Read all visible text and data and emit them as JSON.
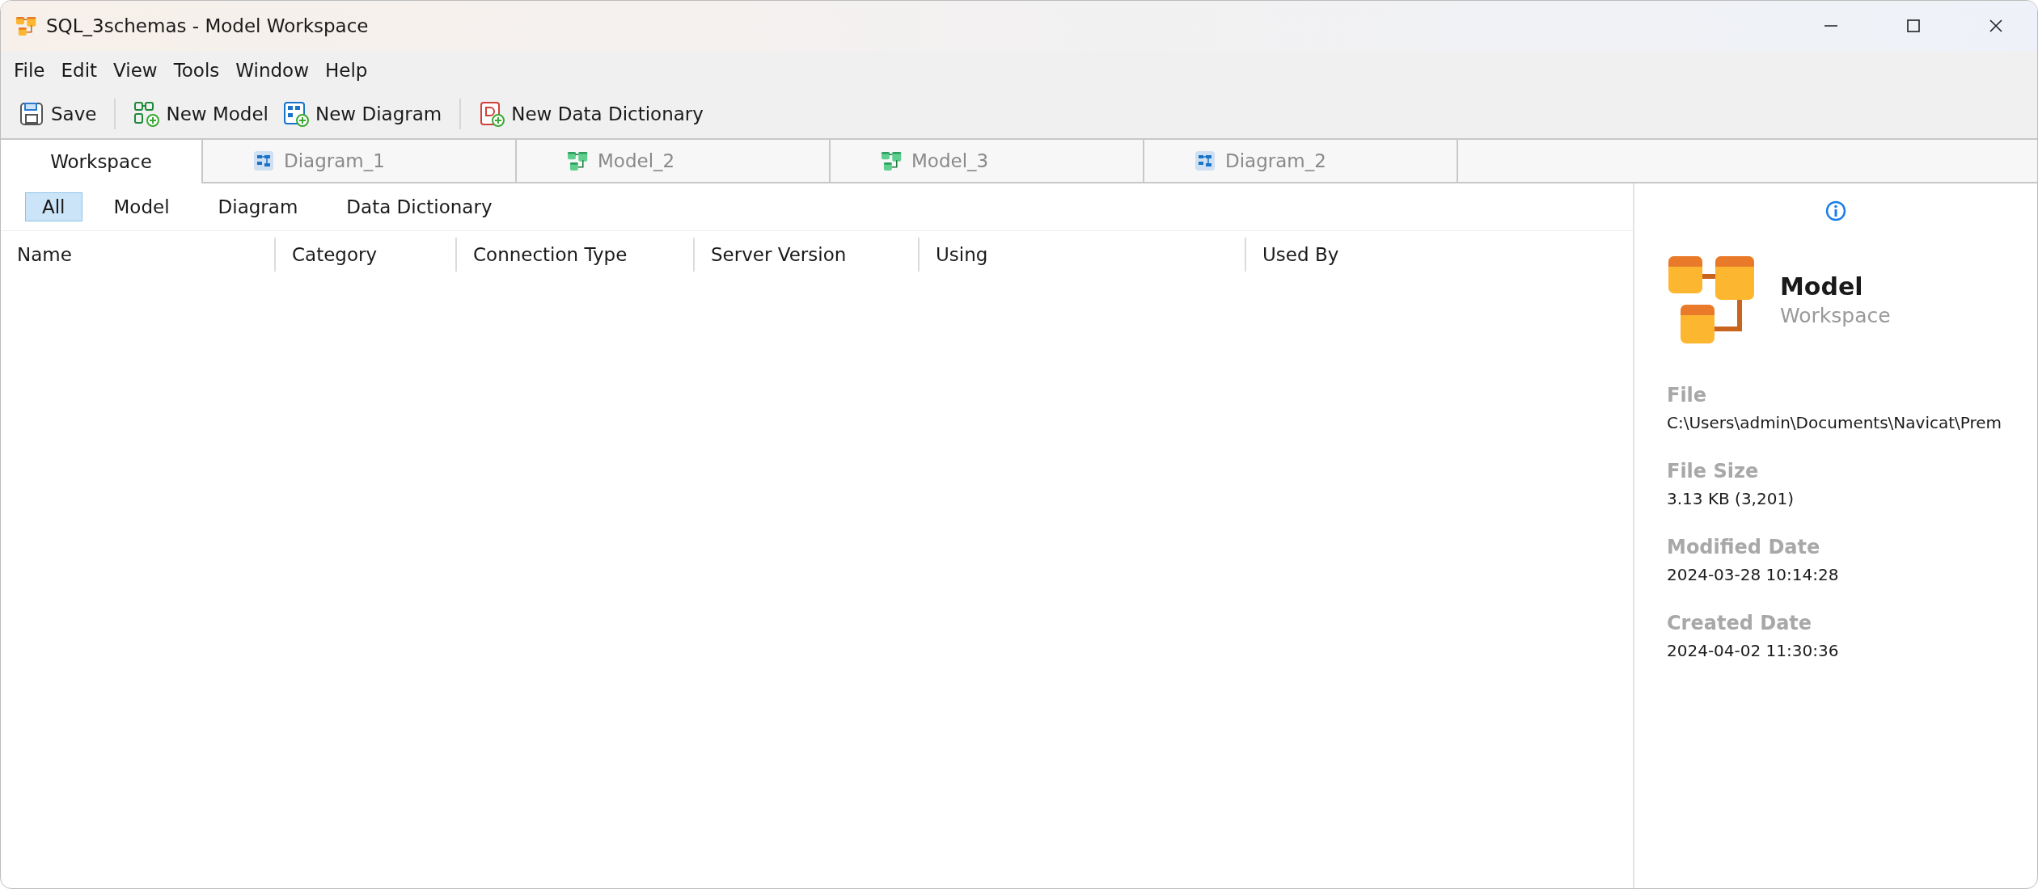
{
  "window": {
    "title": "SQL_3schemas - Model Workspace"
  },
  "menu": [
    "File",
    "Edit",
    "View",
    "Tools",
    "Window",
    "Help"
  ],
  "toolbar": [
    [
      {
        "label": "Save",
        "kind": "save"
      }
    ],
    [
      {
        "label": "New Model",
        "kind": "model"
      },
      {
        "label": "New Diagram",
        "kind": "diagram"
      }
    ],
    [
      {
        "label": "New Data Dictionary",
        "kind": "dictionary"
      }
    ]
  ],
  "tabs": [
    {
      "label": "Workspace",
      "kind": "workspace",
      "selected": true
    },
    {
      "label": "Diagram_1",
      "kind": "diagram",
      "selected": false
    },
    {
      "label": "Model_2",
      "kind": "model",
      "selected": false
    },
    {
      "label": "Model_3",
      "kind": "model",
      "selected": false
    },
    {
      "label": "Diagram_2",
      "kind": "diagram",
      "selected": false
    }
  ],
  "filters": [
    {
      "label": "All",
      "selected": true
    },
    {
      "label": "Model",
      "selected": false
    },
    {
      "label": "Diagram",
      "selected": false
    },
    {
      "label": "Data Dictionary",
      "selected": false
    }
  ],
  "table": {
    "columns": [
      "Name",
      "Category",
      "Connection Type",
      "Server Version",
      "Using",
      "Used By"
    ]
  },
  "info_panel": {
    "title": "Model",
    "subtitle": "Workspace",
    "fields": [
      {
        "label": "File",
        "value": "C:\\Users\\admin\\Documents\\Navicat\\Prem"
      },
      {
        "label": "File Size",
        "value": "3.13 KB (3,201)"
      },
      {
        "label": "Modified Date",
        "value": "2024-03-28 10:14:28"
      },
      {
        "label": "Created Date",
        "value": "2024-04-02 11:30:36"
      }
    ]
  }
}
